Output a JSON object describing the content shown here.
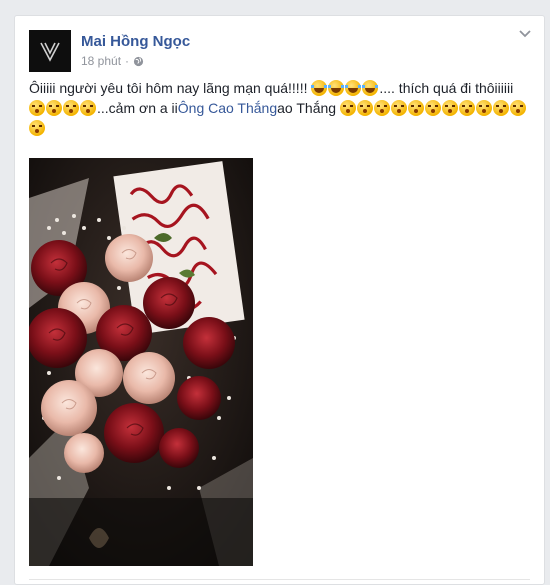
{
  "post": {
    "author": "Mai Hồng Ngọc",
    "time": "18 phút",
    "text_1": "Ôiiiii người yêu tôi hôm nay lãng mạn quá!!!!! ",
    "text_2": ".... thích quá đi thôiiiiii ",
    "text_3": "...cảm ơn a ii",
    "mention": "Ông Cao Thắng",
    "text_4": "ao Thắng ",
    "emoji_laugh": "face-with-tears-of-joy-icon",
    "emoji_kiss": "kissing-face-icon"
  },
  "colors": {
    "author_link": "#365899",
    "meta_gray": "#90949c",
    "text": "#1d2129",
    "background": "#e9ebee"
  }
}
